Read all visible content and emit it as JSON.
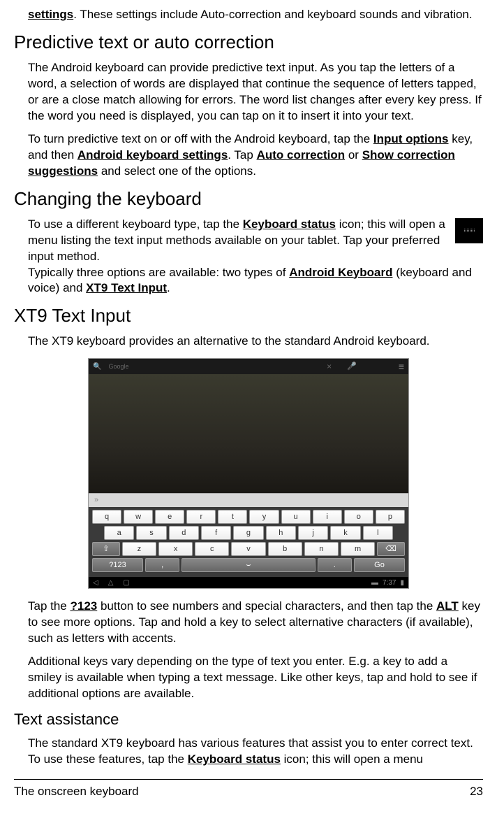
{
  "intro": {
    "bold_start": "settings",
    "rest": ". These settings include Auto-correction and keyboard sounds and vibration."
  },
  "predictive": {
    "heading": "Predictive text or auto correction",
    "para1": "The Android keyboard can provide predictive text input. As you tap the letters of a word, a selection of words are displayed that continue the sequence of letters tapped, or are a close match allowing for errors. The word list changes after every key press. If the word you need is displayed, you can tap on it to insert it into your text.",
    "para2_a": "To turn predictive text on or off with the Android keyboard, tap the ",
    "para2_b": "Input options",
    "para2_c": " key, and then ",
    "para2_d": "Android keyboard settings",
    "para2_e": ". Tap ",
    "para2_f": "Auto correction",
    "para2_g": " or ",
    "para2_h": "Show correction suggestions",
    "para2_i": " and select one of the options."
  },
  "changing": {
    "heading": "Changing the keyboard",
    "para1_a": "To use a different keyboard type, tap the ",
    "para1_b": "Keyboard status",
    "para1_c": " icon; this will open a menu listing the text input methods available on your tablet. Tap your preferred input method.",
    "para2_a": "Typically three options are available: two types of ",
    "para2_b": "Android Keyboard",
    "para2_c": " (keyboard and voice) and ",
    "para2_d": "XT9 Text Input",
    "para2_e": "."
  },
  "xt9": {
    "heading": "XT9 Text Input",
    "para1": "The XT9 keyboard provides an alternative to the standard Android keyboard.",
    "para2_a": "Tap the ",
    "para2_b": "?123",
    "para2_c": " button to see numbers and special characters, and then tap the ",
    "para2_d": "ALT",
    "para2_e": " key to see more options. Tap and hold a key to select alternative characters (if available), such as letters with accents.",
    "para3": "Additional keys vary depending on the type of text you enter. E.g. a key to add a smiley is available when typing a text message. Like other keys, tap and hold to see if additional options are available."
  },
  "keyboard": {
    "search_label": "Google",
    "row1": [
      "q",
      "w",
      "e",
      "r",
      "t",
      "y",
      "u",
      "i",
      "o",
      "p"
    ],
    "row2": [
      "a",
      "s",
      "d",
      "f",
      "g",
      "h",
      "j",
      "k",
      "l"
    ],
    "row3_shift": "⇧",
    "row3": [
      "z",
      "x",
      "c",
      "v",
      "b",
      "n",
      "m"
    ],
    "row3_back": "⌫",
    "row4_123": "?123",
    "row4_comma": ",",
    "row4_space": "⌣",
    "row4_period": ".",
    "row4_go": "Go",
    "time": "7:37"
  },
  "assist": {
    "heading": "Text assistance",
    "para_a": "The standard XT9 keyboard has various features that assist you to enter correct text. To use these features, tap the ",
    "para_b": "Keyboard status",
    "para_c": " icon; this will open a menu"
  },
  "footer": {
    "title": "The onscreen keyboard",
    "page": "23"
  }
}
